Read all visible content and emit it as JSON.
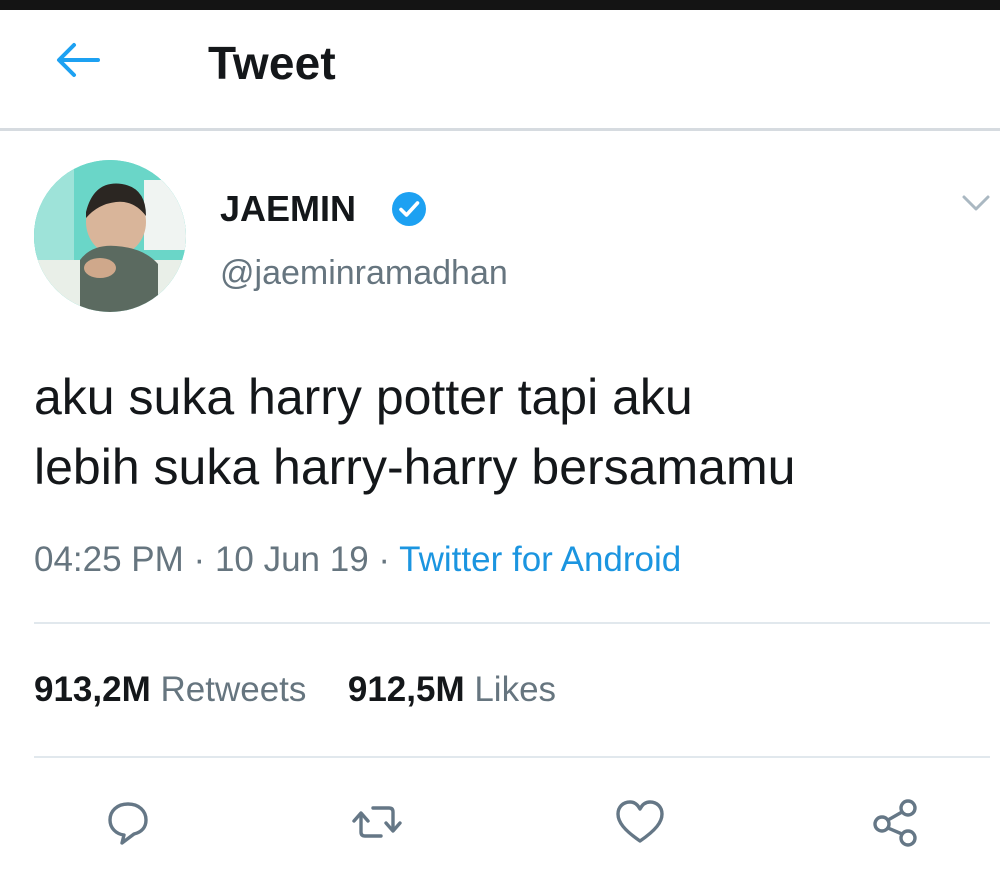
{
  "header": {
    "title": "Tweet",
    "back_icon": "arrow-left-icon",
    "accent_color": "#1da1f2"
  },
  "tweet": {
    "author": {
      "display_name": "JAEMIN",
      "handle": "@jaeminramadhan",
      "verified": true
    },
    "text_lines": [
      "aku suka harry potter tapi aku",
      "lebih suka harry-harry bersamamu"
    ],
    "time": "04:25 PM",
    "date": "10 Jun 19",
    "separator": "·",
    "source": "Twitter for Android",
    "retweets": {
      "count": "913,2M",
      "label": "Retweets"
    },
    "likes": {
      "count": "912,5M",
      "label": "Likes"
    }
  },
  "actions": [
    "reply-icon",
    "retweet-icon",
    "like-icon",
    "share-icon"
  ],
  "colors": {
    "link": "#1b95e0",
    "secondary_text": "#66757f",
    "primary_text": "#14171a",
    "verified_badge": "#1da1f2"
  }
}
